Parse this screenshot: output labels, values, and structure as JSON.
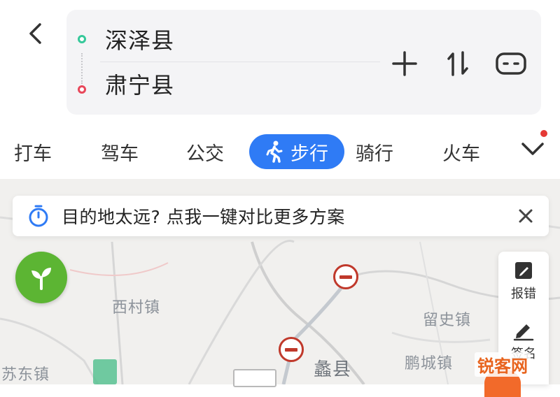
{
  "route": {
    "origin": "深泽县",
    "destination": "肃宁县"
  },
  "modes": [
    {
      "label": "打车"
    },
    {
      "label": "驾车"
    },
    {
      "label": "公交"
    },
    {
      "label": "步行",
      "active": true
    },
    {
      "label": "骑行"
    },
    {
      "label": "火车"
    }
  ],
  "banner": {
    "text": "目的地太远? 点我一键对比更多方案"
  },
  "map": {
    "labels": [
      "西村镇",
      "留史镇",
      "鹏城镇",
      "苏东镇",
      "蠡县"
    ]
  },
  "side_panel": {
    "items": [
      {
        "label": "报错",
        "icon": "report-icon"
      },
      {
        "label": "签名",
        "icon": "pen-icon"
      }
    ]
  },
  "watermark": "锐客网",
  "colors": {
    "accent": "#2f7bf5",
    "origin": "#35c89a",
    "destination": "#e8475a",
    "sprout": "#5cb533"
  }
}
